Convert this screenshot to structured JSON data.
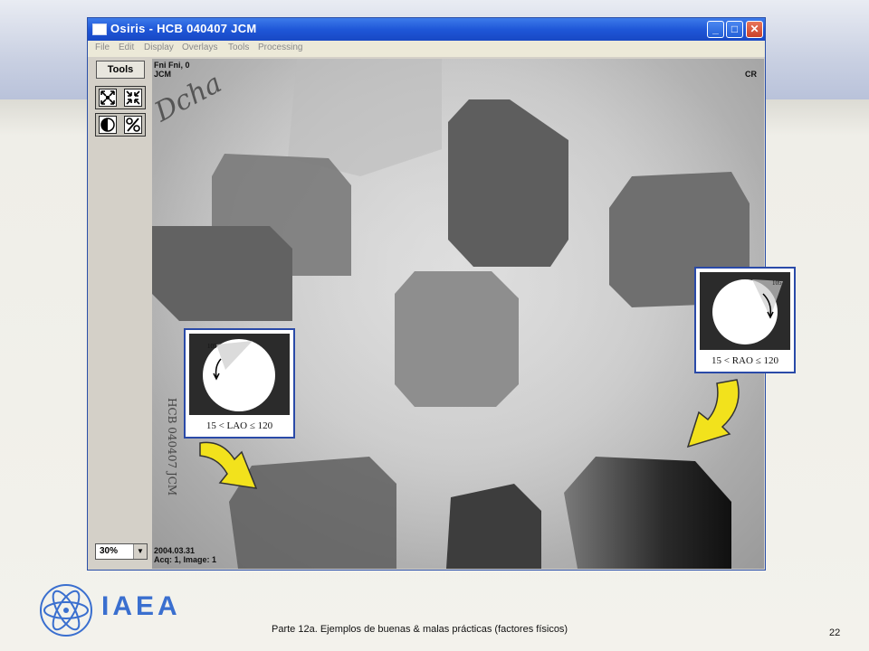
{
  "window": {
    "title": "Osiris - HCB 040407 JCM",
    "controls": {
      "minimize": "_",
      "maximize": "□",
      "close": "✕"
    }
  },
  "menu": [
    "File",
    "Edit",
    "Display",
    "Overlays",
    "Tools",
    "Processing"
  ],
  "toolbar": {
    "tools_label": "Tools",
    "icons": [
      "fit-to-window-icon",
      "actual-size-icon",
      "contrast-icon",
      "percent-icon"
    ],
    "zoom_value": "30%"
  },
  "image": {
    "top_left_line1": "Fni Fni, 0",
    "top_left_line2": "JCM",
    "top_right": "CR",
    "bottom_left_line1": "2004.03.31",
    "bottom_left_line2": "Acq: 1, Image: 1",
    "handwriting_top": "Dcha",
    "handwriting_side": "HCB 040407 JCM"
  },
  "insets": {
    "lao": {
      "caption": "15   < LAO ≤ 120",
      "mark": "105"
    },
    "rao": {
      "caption": "15   < RAO ≤ 120",
      "mark": "105"
    }
  },
  "footer": {
    "logo_text": "IAEA",
    "caption": "Parte 12a. Ejemplos de buenas & malas prácticas (factores físicos)",
    "page": "22"
  },
  "colors": {
    "title_bar": "#1f57d8",
    "inset_border": "#2a4aa8",
    "arrow": "#f2e21c",
    "iaea_blue": "#3a6fcf"
  }
}
